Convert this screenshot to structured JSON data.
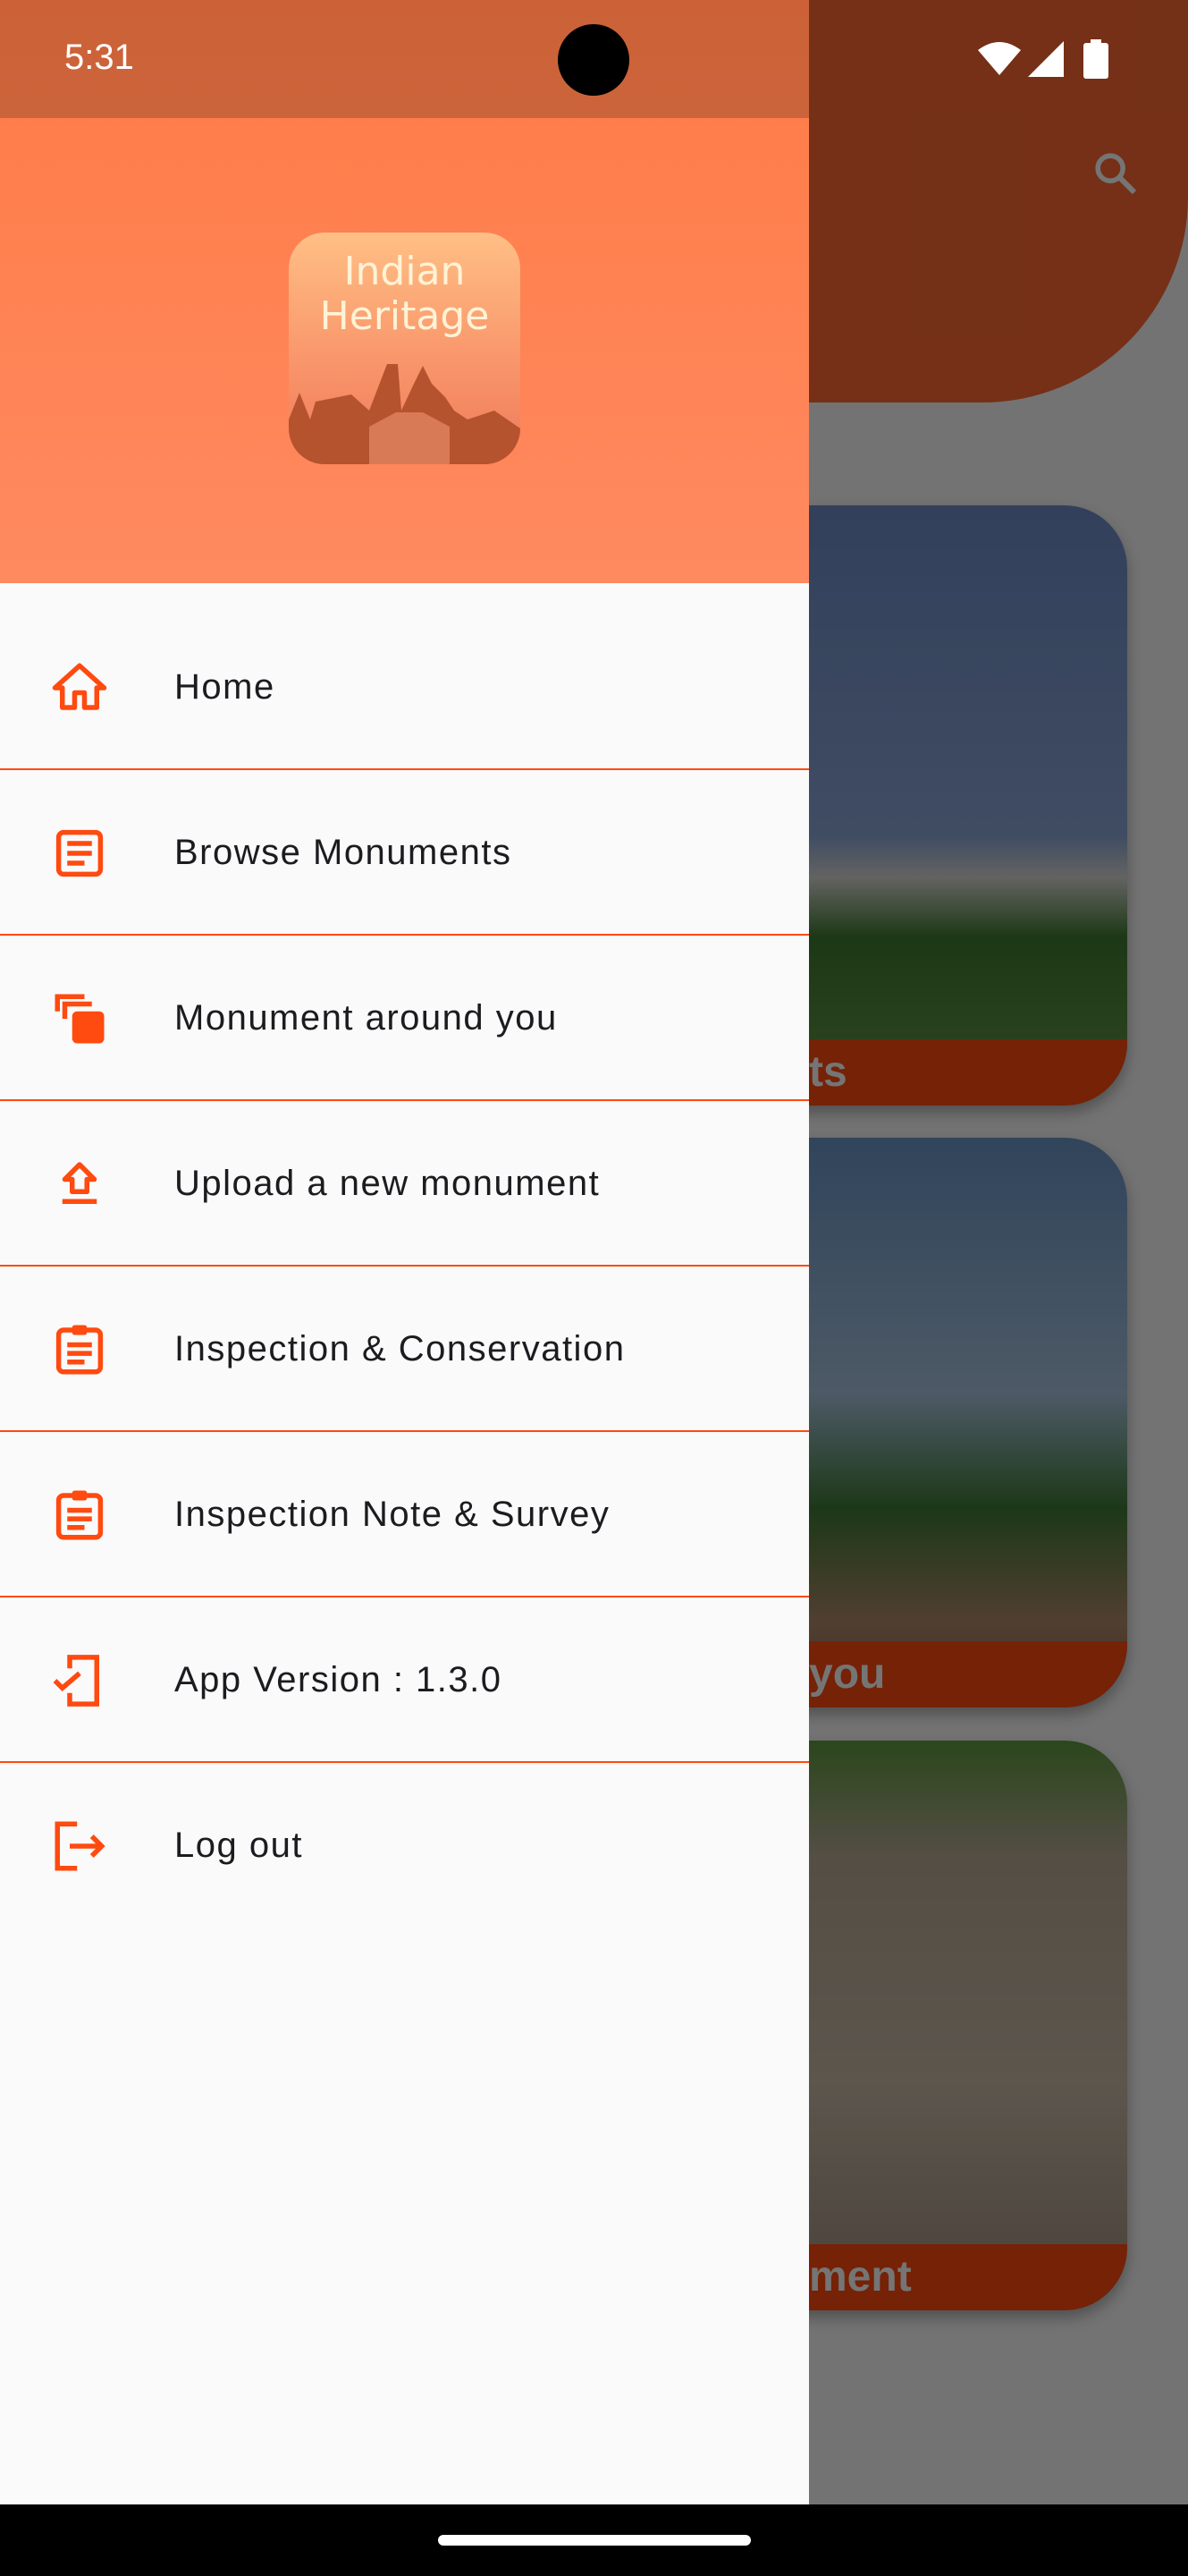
{
  "status_bar": {
    "time": "5:31",
    "icons": [
      "wifi-icon",
      "signal-icon",
      "battery-icon"
    ]
  },
  "colors": {
    "accent": "#ff4a10",
    "header": "#ff7a45",
    "drawer_bg": "#fafafa"
  },
  "background": {
    "search_icon": "search-icon",
    "cards": [
      {
        "caption_visible": "ts"
      },
      {
        "caption_visible": "you"
      },
      {
        "caption_visible": "ment"
      }
    ]
  },
  "drawer": {
    "logo": {
      "line1": "Indian",
      "line2": "Heritage"
    },
    "items": [
      {
        "label": "Home",
        "icon": "home-icon"
      },
      {
        "label": "Browse Monuments",
        "icon": "article-icon"
      },
      {
        "label": "Monument around you",
        "icon": "library-icon"
      },
      {
        "label": "Upload a new monument",
        "icon": "upload-icon"
      },
      {
        "label": "Inspection & Conservation",
        "icon": "clipboard-icon"
      },
      {
        "label": "Inspection Note & Survey",
        "icon": "clipboard-icon"
      },
      {
        "label": "App Version : 1.3.0",
        "icon": "mobile-check-icon"
      },
      {
        "label": "Log out",
        "icon": "logout-icon"
      }
    ]
  }
}
